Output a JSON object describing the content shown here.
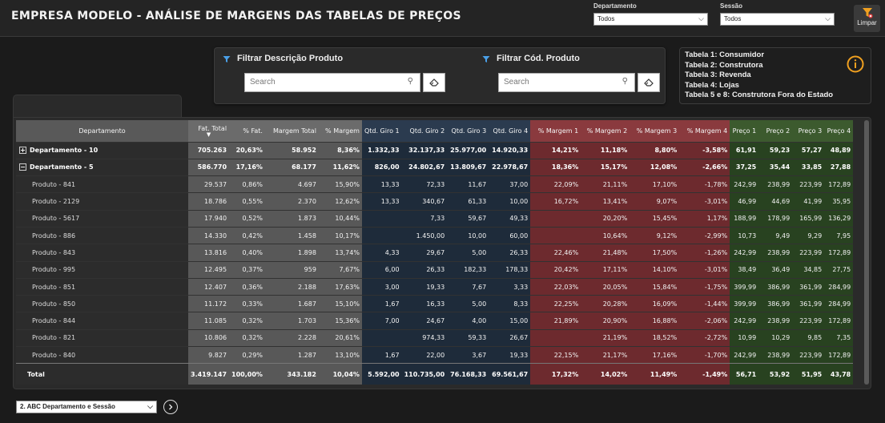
{
  "header": {
    "title": "EMPRESA MODELO - ANÁLISE DE MARGENS DAS TABELAS DE PREÇOS",
    "departamento": {
      "label": "Departamento",
      "value": "Todos"
    },
    "sessao": {
      "label": "Sessão",
      "value": "Todos"
    },
    "clear_label": "Limpar"
  },
  "filters": {
    "descricao": {
      "title": "Filtrar Descrição Produto",
      "placeholder": "Search"
    },
    "codigo": {
      "title": "Filtrar Cód. Produto",
      "placeholder": "Search"
    }
  },
  "legend": {
    "lines": [
      "Tabela 1: Consumidor",
      "Tabela 2: Construtora",
      "Tabela 3: Revenda",
      "Tabela 4: Lojas",
      "Tabela 5 e 8: Construtora Fora do Estado"
    ]
  },
  "table": {
    "columns": [
      "Departamento",
      "Fat. Total",
      "% Fat.",
      "Margem Total",
      "% Margem",
      "Qtd. Giro 1",
      "Qtd. Giro 2",
      "Qtd. Giro 3",
      "Qtd. Giro 4",
      "% Margem 1",
      "% Margem 2",
      "% Margem 3",
      "% Margem 4",
      "Preço 1",
      "Preço 2",
      "Preço 3",
      "Preço 4"
    ],
    "rows": [
      {
        "name": "Departamento - 10",
        "expander": "⊞",
        "kind": "top",
        "values": [
          "705.263",
          "20,63%",
          "58.952",
          "8,36%",
          "1.332,33",
          "32.137,33",
          "25.977,00",
          "14.920,33",
          "14,21%",
          "11,18%",
          "8,80%",
          "-3,58%",
          "61,91",
          "59,23",
          "57,27",
          "48,89"
        ]
      },
      {
        "name": "Departamento - 5",
        "expander": "⊟",
        "kind": "top",
        "values": [
          "586.770",
          "17,16%",
          "68.177",
          "11,62%",
          "826,00",
          "24.802,67",
          "13.809,67",
          "22.978,67",
          "18,36%",
          "15,17%",
          "12,08%",
          "-2,66%",
          "37,25",
          "35,44",
          "33,85",
          "27,88"
        ]
      },
      {
        "name": "Produto - 841",
        "kind": "child",
        "values": [
          "29.537",
          "0,86%",
          "4.697",
          "15,90%",
          "13,33",
          "72,33",
          "11,67",
          "37,00",
          "22,09%",
          "21,11%",
          "17,10%",
          "-1,78%",
          "242,99",
          "238,99",
          "223,99",
          "172,89"
        ]
      },
      {
        "name": "Produto - 2129",
        "kind": "child",
        "values": [
          "18.786",
          "0,55%",
          "2.370",
          "12,62%",
          "13,33",
          "340,67",
          "61,33",
          "10,00",
          "16,72%",
          "13,41%",
          "9,07%",
          "-3,01%",
          "46,99",
          "44,69",
          "41,99",
          "35,95"
        ]
      },
      {
        "name": "Produto - 5617",
        "kind": "child",
        "values": [
          "17.940",
          "0,52%",
          "1.873",
          "10,44%",
          "",
          "7,33",
          "59,67",
          "49,33",
          "",
          "20,20%",
          "15,45%",
          "1,17%",
          "188,99",
          "178,99",
          "165,99",
          "136,29"
        ]
      },
      {
        "name": "Produto - 886",
        "kind": "child",
        "values": [
          "14.330",
          "0,42%",
          "1.458",
          "10,17%",
          "",
          "1.450,00",
          "10,00",
          "60,00",
          "",
          "10,64%",
          "9,12%",
          "-2,99%",
          "10,73",
          "9,49",
          "9,29",
          "7,95"
        ]
      },
      {
        "name": "Produto - 843",
        "kind": "child",
        "values": [
          "13.816",
          "0,40%",
          "1.898",
          "13,74%",
          "4,33",
          "29,67",
          "5,00",
          "26,33",
          "22,46%",
          "21,48%",
          "17,50%",
          "-1,26%",
          "242,99",
          "238,99",
          "223,99",
          "172,89"
        ]
      },
      {
        "name": "Produto - 995",
        "kind": "child",
        "values": [
          "12.495",
          "0,37%",
          "959",
          "7,67%",
          "6,00",
          "26,33",
          "182,33",
          "178,33",
          "20,42%",
          "17,11%",
          "14,10%",
          "-3,01%",
          "38,49",
          "36,49",
          "34,85",
          "27,75"
        ]
      },
      {
        "name": "Produto - 851",
        "kind": "child",
        "values": [
          "12.407",
          "0,36%",
          "2.188",
          "17,63%",
          "3,00",
          "19,33",
          "7,67",
          "3,33",
          "22,03%",
          "20,05%",
          "15,84%",
          "-1,75%",
          "399,99",
          "386,99",
          "361,99",
          "284,99"
        ]
      },
      {
        "name": "Produto - 850",
        "kind": "child",
        "values": [
          "11.172",
          "0,33%",
          "1.687",
          "15,10%",
          "1,67",
          "16,33",
          "5,00",
          "8,33",
          "22,25%",
          "20,28%",
          "16,09%",
          "-1,44%",
          "399,99",
          "386,99",
          "361,99",
          "284,99"
        ]
      },
      {
        "name": "Produto - 844",
        "kind": "child",
        "values": [
          "11.085",
          "0,32%",
          "1.703",
          "15,36%",
          "7,00",
          "24,67",
          "4,00",
          "15,00",
          "21,89%",
          "20,90%",
          "16,88%",
          "-2,06%",
          "242,99",
          "238,99",
          "223,99",
          "172,89"
        ]
      },
      {
        "name": "Produto - 821",
        "kind": "child",
        "values": [
          "10.806",
          "0,32%",
          "2.228",
          "20,61%",
          "",
          "974,33",
          "59,33",
          "26,67",
          "",
          "21,19%",
          "18,52%",
          "-2,72%",
          "10,99",
          "10,29",
          "9,85",
          "7,35"
        ]
      },
      {
        "name": "Produto - 840",
        "kind": "child",
        "values": [
          "9.827",
          "0,29%",
          "1.287",
          "13,10%",
          "1,67",
          "22,00",
          "3,67",
          "19,33",
          "22,15%",
          "21,17%",
          "17,16%",
          "-1,70%",
          "242,99",
          "238,99",
          "223,99",
          "172,89"
        ]
      }
    ],
    "total": {
      "name": "Total",
      "values": [
        "3.419.147",
        "100,00%",
        "343.182",
        "10,04%",
        "5.592,00",
        "110.735,00",
        "76.168,33",
        "69.561,67",
        "17,32%",
        "14,02%",
        "11,49%",
        "-1,49%",
        "56,71",
        "53,92",
        "51,95",
        "43,78"
      ]
    }
  },
  "footer": {
    "page_select": "2. ABC Departamento e Sessão"
  },
  "colors": {
    "gray_band": "#585858",
    "navy_band": "#1e2b3a",
    "red_band": "#6d2a2e",
    "green_band": "#284220"
  },
  "icons": {
    "filter": "filter-icon",
    "info": "info-icon",
    "eraser": "eraser-icon",
    "search": "search-icon",
    "next": "next-page-icon"
  }
}
